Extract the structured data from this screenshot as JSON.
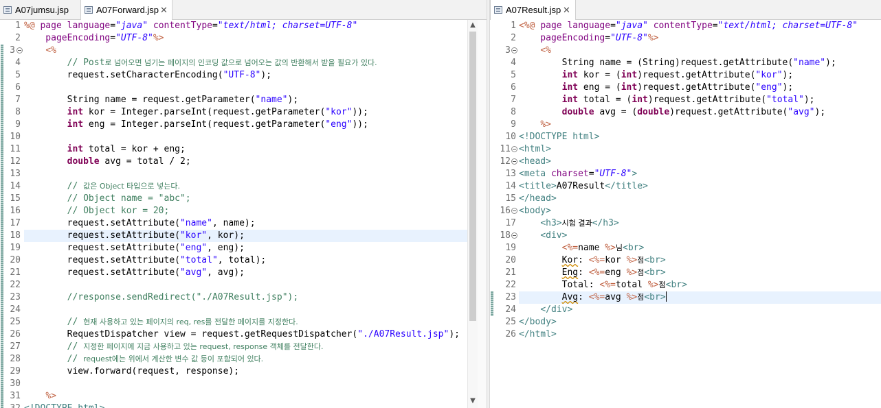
{
  "left_pane": {
    "tabs": [
      {
        "label": "A07jumsu.jsp",
        "active": false,
        "closable": false
      },
      {
        "label": "A07Forward.jsp",
        "active": true,
        "closable": true
      }
    ],
    "close_glyph": "✕",
    "current_line": 18,
    "lines": [
      {
        "n": "1",
        "fold": false,
        "tokens": [
          [
            "jsp",
            "%@ "
          ],
          [
            "attr",
            "page "
          ],
          [
            "attr",
            "language"
          ],
          [
            "",
            "="
          ],
          [
            "aval",
            "\"java\""
          ],
          [
            "",
            " "
          ],
          [
            "attr",
            "contentType"
          ],
          [
            "",
            "="
          ],
          [
            "aval",
            "\"text/html; charset=UTF-8\""
          ]
        ]
      },
      {
        "n": "2",
        "fold": false,
        "tokens": [
          [
            "",
            " "
          ],
          [
            "attr",
            "   pageEncoding"
          ],
          [
            "",
            "="
          ],
          [
            "aval",
            "\"UTF-8\""
          ],
          [
            "jsp",
            "%>"
          ]
        ]
      },
      {
        "n": "3",
        "fold": true,
        "tokens": [
          [
            "",
            "    "
          ],
          [
            "jsp",
            "<%"
          ]
        ]
      },
      {
        "n": "4",
        "fold": false,
        "tokens": [
          [
            "",
            "        "
          ],
          [
            "com",
            "// Post"
          ],
          [
            "com kr",
            "로 넘어오면 넘기는 페이지의 인코딩 값으로 넘어오는 값의 반환해서 받을 필요가 있다."
          ]
        ]
      },
      {
        "n": "5",
        "fold": false,
        "tokens": [
          [
            "",
            "        request.setCharacterEncoding("
          ],
          [
            "str",
            "\"UTF-8\""
          ],
          [
            "",
            ");"
          ]
        ]
      },
      {
        "n": "6",
        "fold": false,
        "tokens": [
          [
            "",
            ""
          ]
        ]
      },
      {
        "n": "7",
        "fold": false,
        "tokens": [
          [
            "",
            "        String name = request.getParameter("
          ],
          [
            "str",
            "\"name\""
          ],
          [
            "",
            ");"
          ]
        ]
      },
      {
        "n": "8",
        "fold": false,
        "tokens": [
          [
            "",
            "        "
          ],
          [
            "kw",
            "int"
          ],
          [
            "",
            " kor = Integer.parseInt(request.getParameter("
          ],
          [
            "str",
            "\"kor\""
          ],
          [
            "",
            "));"
          ]
        ]
      },
      {
        "n": "9",
        "fold": false,
        "tokens": [
          [
            "",
            "        "
          ],
          [
            "kw",
            "int"
          ],
          [
            "",
            " eng = Integer.parseInt(request.getParameter("
          ],
          [
            "str",
            "\"eng\""
          ],
          [
            "",
            "));"
          ]
        ]
      },
      {
        "n": "10",
        "fold": false,
        "tokens": [
          [
            "",
            ""
          ]
        ]
      },
      {
        "n": "11",
        "fold": false,
        "tokens": [
          [
            "",
            "        "
          ],
          [
            "kw",
            "int"
          ],
          [
            "",
            " total = kor + eng;"
          ]
        ]
      },
      {
        "n": "12",
        "fold": false,
        "tokens": [
          [
            "",
            "        "
          ],
          [
            "kw",
            "double"
          ],
          [
            "",
            " avg = total / 2;"
          ]
        ]
      },
      {
        "n": "13",
        "fold": false,
        "tokens": [
          [
            "",
            ""
          ]
        ]
      },
      {
        "n": "14",
        "fold": false,
        "tokens": [
          [
            "",
            "        "
          ],
          [
            "com",
            "// "
          ],
          [
            "com kr",
            "값은 Object 타입으로 넣는다."
          ]
        ]
      },
      {
        "n": "15",
        "fold": false,
        "tokens": [
          [
            "",
            "        "
          ],
          [
            "com",
            "// Object name = \"abc\";"
          ]
        ]
      },
      {
        "n": "16",
        "fold": false,
        "tokens": [
          [
            "",
            "        "
          ],
          [
            "com",
            "// Object kor = 20;"
          ]
        ]
      },
      {
        "n": "17",
        "fold": false,
        "tokens": [
          [
            "",
            "        request.setAttribute("
          ],
          [
            "str",
            "\"name\""
          ],
          [
            "",
            ", name);"
          ]
        ]
      },
      {
        "n": "18",
        "fold": false,
        "tokens": [
          [
            "",
            "        request.setAttribute("
          ],
          [
            "str",
            "\"kor\""
          ],
          [
            "",
            ", kor);"
          ]
        ]
      },
      {
        "n": "19",
        "fold": false,
        "tokens": [
          [
            "",
            "        request.setAttribute("
          ],
          [
            "str",
            "\"eng\""
          ],
          [
            "",
            ", eng);"
          ]
        ]
      },
      {
        "n": "20",
        "fold": false,
        "tokens": [
          [
            "",
            "        request.setAttribute("
          ],
          [
            "str",
            "\"total\""
          ],
          [
            "",
            ", total);"
          ]
        ]
      },
      {
        "n": "21",
        "fold": false,
        "tokens": [
          [
            "",
            "        request.setAttribute("
          ],
          [
            "str",
            "\"avg\""
          ],
          [
            "",
            ", avg);"
          ]
        ]
      },
      {
        "n": "22",
        "fold": false,
        "tokens": [
          [
            "",
            ""
          ]
        ]
      },
      {
        "n": "23",
        "fold": false,
        "tokens": [
          [
            "",
            "        "
          ],
          [
            "com",
            "//response.sendRedirect(\"./A07Result.jsp\");"
          ]
        ]
      },
      {
        "n": "24",
        "fold": false,
        "tokens": [
          [
            "",
            ""
          ]
        ]
      },
      {
        "n": "25",
        "fold": false,
        "tokens": [
          [
            "",
            "        "
          ],
          [
            "com",
            "// "
          ],
          [
            "com kr",
            "현재 사용하고 있는 페이지의 req, res를 전달한 페이지를 지정한다."
          ]
        ]
      },
      {
        "n": "26",
        "fold": false,
        "tokens": [
          [
            "",
            "        RequestDispatcher view = request.getRequestDispatcher("
          ],
          [
            "str",
            "\"./A07Result.jsp\""
          ],
          [
            "",
            ");"
          ]
        ]
      },
      {
        "n": "27",
        "fold": false,
        "tokens": [
          [
            "",
            "        "
          ],
          [
            "com",
            "// "
          ],
          [
            "com kr",
            "지정한 페이지에 지금 사용하고 있는 request, response 객체를 전달한다."
          ]
        ]
      },
      {
        "n": "28",
        "fold": false,
        "tokens": [
          [
            "",
            "        "
          ],
          [
            "com",
            "// "
          ],
          [
            "com kr",
            "request에는 위에서 계산한 변수 값 등이 포함되어 있다."
          ]
        ]
      },
      {
        "n": "29",
        "fold": false,
        "tokens": [
          [
            "",
            "        view.forward(request, response);"
          ]
        ]
      },
      {
        "n": "30",
        "fold": false,
        "tokens": [
          [
            "",
            ""
          ]
        ]
      },
      {
        "n": "31",
        "fold": false,
        "tokens": [
          [
            "",
            "    "
          ],
          [
            "jsp",
            "%>"
          ]
        ]
      },
      {
        "n": "32",
        "fold": false,
        "tokens": [
          [
            "tag",
            "<!DOCTYPE html>"
          ]
        ]
      }
    ]
  },
  "right_pane": {
    "tabs": [
      {
        "label": "A07Result.jsp",
        "active": true,
        "closable": true
      }
    ],
    "close_glyph": "✕",
    "current_line": 23,
    "lines": [
      {
        "n": "1",
        "fold": false,
        "tokens": [
          [
            "jsp",
            "<%@ "
          ],
          [
            "attr",
            "page "
          ],
          [
            "attr",
            "language"
          ],
          [
            "",
            "="
          ],
          [
            "aval",
            "\"java\""
          ],
          [
            "",
            " "
          ],
          [
            "attr",
            "contentType"
          ],
          [
            "",
            "="
          ],
          [
            "aval",
            "\"text/html; charset=UTF-8\""
          ]
        ]
      },
      {
        "n": "2",
        "fold": false,
        "tokens": [
          [
            "attr",
            "    pageEncoding"
          ],
          [
            "",
            "="
          ],
          [
            "aval",
            "\"UTF-8\""
          ],
          [
            "jsp",
            "%>"
          ]
        ]
      },
      {
        "n": "3",
        "fold": true,
        "tokens": [
          [
            "",
            "    "
          ],
          [
            "jsp",
            "<%"
          ]
        ]
      },
      {
        "n": "4",
        "fold": false,
        "tokens": [
          [
            "",
            "        String name = (String)request.getAttribute("
          ],
          [
            "str",
            "\"name\""
          ],
          [
            "",
            ");"
          ]
        ]
      },
      {
        "n": "5",
        "fold": false,
        "tokens": [
          [
            "",
            "        "
          ],
          [
            "kw",
            "int"
          ],
          [
            "",
            " kor = ("
          ],
          [
            "kw",
            "int"
          ],
          [
            "",
            ")request.getAttribute("
          ],
          [
            "str",
            "\"kor\""
          ],
          [
            "",
            ");"
          ]
        ]
      },
      {
        "n": "6",
        "fold": false,
        "tokens": [
          [
            "",
            "        "
          ],
          [
            "kw",
            "int"
          ],
          [
            "",
            " eng = ("
          ],
          [
            "kw",
            "int"
          ],
          [
            "",
            ")request.getAttribute("
          ],
          [
            "str",
            "\"eng\""
          ],
          [
            "",
            ");"
          ]
        ]
      },
      {
        "n": "7",
        "fold": false,
        "tokens": [
          [
            "",
            "        "
          ],
          [
            "kw",
            "int"
          ],
          [
            "",
            " total = ("
          ],
          [
            "kw",
            "int"
          ],
          [
            "",
            ")request.getAttribute("
          ],
          [
            "str",
            "\"total\""
          ],
          [
            "",
            ");"
          ]
        ]
      },
      {
        "n": "8",
        "fold": false,
        "tokens": [
          [
            "",
            "        "
          ],
          [
            "kw",
            "double"
          ],
          [
            "",
            " avg = ("
          ],
          [
            "kw",
            "double"
          ],
          [
            "",
            ")request.getAttribute("
          ],
          [
            "str",
            "\"avg\""
          ],
          [
            "",
            ");"
          ]
        ]
      },
      {
        "n": "9",
        "fold": false,
        "tokens": [
          [
            "",
            "    "
          ],
          [
            "jsp",
            "%>"
          ]
        ]
      },
      {
        "n": "10",
        "fold": false,
        "tokens": [
          [
            "tag",
            "<!DOCTYPE html>"
          ]
        ]
      },
      {
        "n": "11",
        "fold": true,
        "tokens": [
          [
            "tag",
            "<html>"
          ]
        ]
      },
      {
        "n": "12",
        "fold": true,
        "tokens": [
          [
            "tag",
            "<head>"
          ]
        ]
      },
      {
        "n": "13",
        "fold": false,
        "tokens": [
          [
            "tag",
            "<meta "
          ],
          [
            "attr",
            "charset"
          ],
          [
            "",
            "="
          ],
          [
            "aval",
            "\"UTF-8\""
          ],
          [
            "tag",
            ">"
          ]
        ]
      },
      {
        "n": "14",
        "fold": false,
        "tokens": [
          [
            "tag",
            "<title>"
          ],
          [
            "",
            "A07Result"
          ],
          [
            "tag",
            "</title>"
          ]
        ]
      },
      {
        "n": "15",
        "fold": false,
        "tokens": [
          [
            "tag",
            "</head>"
          ]
        ]
      },
      {
        "n": "16",
        "fold": true,
        "tokens": [
          [
            "tag",
            "<body>"
          ]
        ]
      },
      {
        "n": "17",
        "fold": false,
        "tokens": [
          [
            "",
            "    "
          ],
          [
            "tag",
            "<h3>"
          ],
          [
            "kr",
            "시험 결과"
          ],
          [
            "tag",
            "</h3>"
          ]
        ]
      },
      {
        "n": "18",
        "fold": true,
        "tokens": [
          [
            "",
            "    "
          ],
          [
            "tag",
            "<div>"
          ]
        ]
      },
      {
        "n": "19",
        "fold": false,
        "tokens": [
          [
            "",
            "        "
          ],
          [
            "jsp",
            "<%="
          ],
          [
            "",
            "name "
          ],
          [
            "jsp",
            "%>"
          ],
          [
            "kr",
            "님"
          ],
          [
            "tag",
            "<br>"
          ]
        ]
      },
      {
        "n": "20",
        "fold": false,
        "tokens": [
          [
            "",
            "        "
          ],
          [
            "wavy",
            "Kor"
          ],
          [
            "",
            ": "
          ],
          [
            "jsp",
            "<%="
          ],
          [
            "",
            "kor "
          ],
          [
            "jsp",
            "%>"
          ],
          [
            "kr",
            "점"
          ],
          [
            "tag",
            "<br>"
          ]
        ]
      },
      {
        "n": "21",
        "fold": false,
        "tokens": [
          [
            "",
            "        "
          ],
          [
            "wavy",
            "Eng"
          ],
          [
            "",
            ": "
          ],
          [
            "jsp",
            "<%="
          ],
          [
            "",
            "eng "
          ],
          [
            "jsp",
            "%>"
          ],
          [
            "kr",
            "점"
          ],
          [
            "tag",
            "<br>"
          ]
        ]
      },
      {
        "n": "22",
        "fold": false,
        "tokens": [
          [
            "",
            "        Total: "
          ],
          [
            "jsp",
            "<%="
          ],
          [
            "",
            "total "
          ],
          [
            "jsp",
            "%>"
          ],
          [
            "kr",
            "점"
          ],
          [
            "tag",
            "<br>"
          ]
        ]
      },
      {
        "n": "23",
        "fold": false,
        "caret": true,
        "tokens": [
          [
            "",
            "        "
          ],
          [
            "wavy",
            "Avg"
          ],
          [
            "",
            ": "
          ],
          [
            "jsp",
            "<%="
          ],
          [
            "",
            "avg "
          ],
          [
            "jsp",
            "%>"
          ],
          [
            "kr",
            "점"
          ],
          [
            "tag",
            "<br>"
          ]
        ]
      },
      {
        "n": "24",
        "fold": false,
        "tokens": [
          [
            "",
            "    "
          ],
          [
            "tag",
            "</div>"
          ]
        ]
      },
      {
        "n": "25",
        "fold": false,
        "tokens": [
          [
            "tag",
            "</body>"
          ]
        ]
      },
      {
        "n": "26",
        "fold": false,
        "tokens": [
          [
            "tag",
            "</html>"
          ]
        ]
      }
    ]
  },
  "colors": {
    "keyword": "#7f0055",
    "string": "#2a00ff",
    "comment": "#3f7f5f",
    "tag": "#3f7f7f",
    "attribute": "#7f007f",
    "jsp_delimiter": "#bf5f3f",
    "current_line_highlight": "#e8f2fe"
  },
  "scroll_arrows": {
    "up": "▲",
    "down": "▼"
  }
}
